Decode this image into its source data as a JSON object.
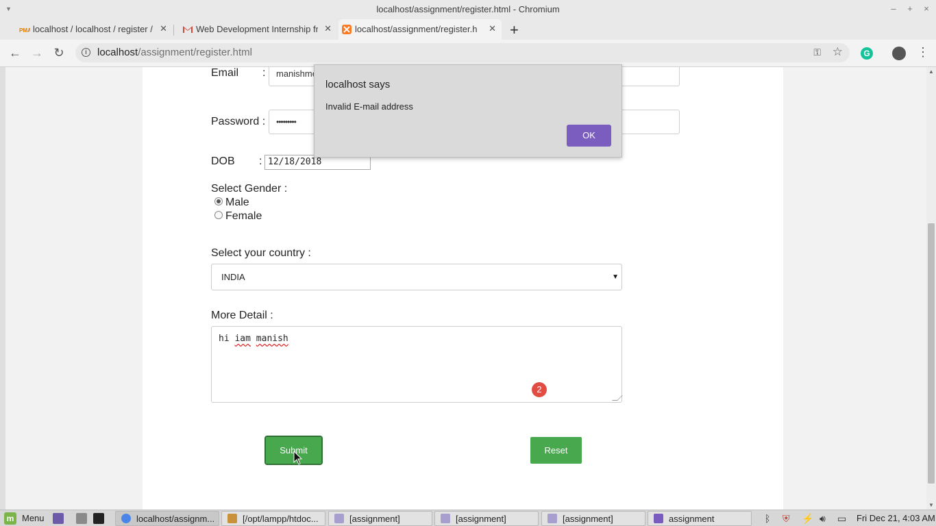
{
  "window": {
    "title": "localhost/assignment/register.html - Chromium"
  },
  "tabs": [
    {
      "label": "localhost / localhost / register / p",
      "icon": "phpmyadmin-icon"
    },
    {
      "label": "Web Development Internship fr",
      "icon": "gmail-icon"
    },
    {
      "label": "localhost/assignment/register.h",
      "icon": "xampp-icon"
    }
  ],
  "toolbar": {
    "url_host": "localhost",
    "url_path": "/assignment/register.html"
  },
  "form": {
    "email_label": "Email",
    "email_value": "manishme",
    "password_label": "Password :",
    "password_value": "•••••••••",
    "dob_label": "DOB",
    "dob_value": "12/18/2018",
    "colon": ":",
    "gender_label": "Select Gender :",
    "gender_options": [
      "Male",
      "Female"
    ],
    "gender_selected": "Male",
    "country_label": "Select your country :",
    "country_value": "INDIA",
    "detail_label": "More Detail :",
    "detail_words": [
      "hi",
      "iam",
      "manish"
    ],
    "grammar_badge_count": "2",
    "submit_label": "Submit",
    "reset_label": "Reset"
  },
  "dialog": {
    "title": "localhost says",
    "message": "Invalid E-mail address",
    "ok_label": "OK",
    "ok_color": "#7b5cbf"
  },
  "taskbar": {
    "menu_label": "Menu",
    "items": [
      {
        "label": "localhost/assignm...",
        "icon": "chromium-icon",
        "active": true
      },
      {
        "label": "[/opt/lampp/htdoc...",
        "icon": "text-editor-icon",
        "active": false
      },
      {
        "label": "[assignment]",
        "icon": "folder-icon",
        "active": false
      },
      {
        "label": "[assignment]",
        "icon": "folder-icon",
        "active": false
      },
      {
        "label": "[assignment]",
        "icon": "folder-icon",
        "active": false
      },
      {
        "label": "assignment",
        "icon": "folder-icon",
        "active": false
      }
    ],
    "clock": "Fri Dec 21, 4:03 AM"
  },
  "colors": {
    "button_green": "#47a84d",
    "badge_red": "#e14d43"
  }
}
